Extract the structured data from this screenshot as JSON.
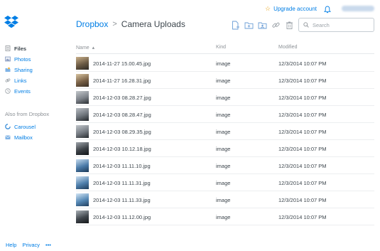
{
  "header": {
    "upgrade_label": "Upgrade account",
    "breadcrumb_root": "Dropbox",
    "breadcrumb_separator": ">",
    "breadcrumb_current": "Camera Uploads",
    "search_placeholder": "Search"
  },
  "sidebar": {
    "items": [
      {
        "label": "Files",
        "icon": "files-icon"
      },
      {
        "label": "Photos",
        "icon": "photos-icon"
      },
      {
        "label": "Sharing",
        "icon": "sharing-icon"
      },
      {
        "label": "Links",
        "icon": "links-icon"
      },
      {
        "label": "Events",
        "icon": "events-icon"
      }
    ],
    "section_label": "Also from Dropbox",
    "apps": [
      {
        "label": "Carousel",
        "icon": "carousel-icon"
      },
      {
        "label": "Mailbox",
        "icon": "mailbox-icon"
      }
    ]
  },
  "footer": {
    "help": "Help",
    "privacy": "Privacy",
    "more": "•••"
  },
  "table": {
    "columns": {
      "name": "Name",
      "sort_indicator": "▴",
      "kind": "Kind",
      "modified": "Modified"
    },
    "rows": [
      {
        "name": "2014-11-27 15.00.45.jpg",
        "kind": "image",
        "modified": "12/3/2014 10:07 PM"
      },
      {
        "name": "2014-11-27 16.28.31.jpg",
        "kind": "image",
        "modified": "12/3/2014 10:07 PM"
      },
      {
        "name": "2014-12-03 08.28.27.jpg",
        "kind": "image",
        "modified": "12/3/2014 10:07 PM"
      },
      {
        "name": "2014-12-03 08.28.47.jpg",
        "kind": "image",
        "modified": "12/3/2014 10:07 PM"
      },
      {
        "name": "2014-12-03 08.29.35.jpg",
        "kind": "image",
        "modified": "12/3/2014 10:07 PM"
      },
      {
        "name": "2014-12-03 10.12.18.jpg",
        "kind": "image",
        "modified": "12/3/2014 10:07 PM"
      },
      {
        "name": "2014-12-03 11.11.10.jpg",
        "kind": "image",
        "modified": "12/3/2014 10:07 PM"
      },
      {
        "name": "2014-12-03 11.11.31.jpg",
        "kind": "image",
        "modified": "12/3/2014 10:07 PM"
      },
      {
        "name": "2014-12-03 11.11.33.jpg",
        "kind": "image",
        "modified": "12/3/2014 10:07 PM"
      },
      {
        "name": "2014-12-03 11.12.00.jpg",
        "kind": "image",
        "modified": "12/3/2014 10:07 PM"
      }
    ]
  },
  "colors": {
    "accent": "#007ee5",
    "text": "#3d464d",
    "muted": "#8d9297",
    "upgrade_star": "#e8a317"
  }
}
